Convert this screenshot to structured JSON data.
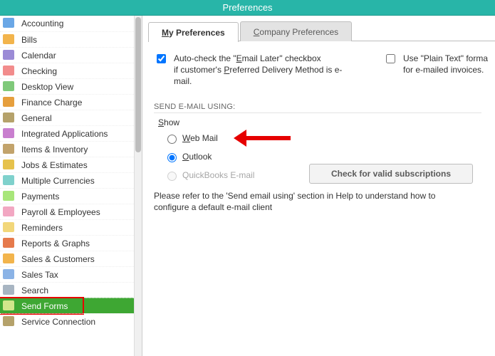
{
  "title": "Preferences",
  "sidebar": {
    "items": [
      {
        "label": "Accounting"
      },
      {
        "label": "Bills"
      },
      {
        "label": "Calendar"
      },
      {
        "label": "Checking"
      },
      {
        "label": "Desktop View"
      },
      {
        "label": "Finance Charge"
      },
      {
        "label": "General"
      },
      {
        "label": "Integrated Applications"
      },
      {
        "label": "Items & Inventory"
      },
      {
        "label": "Jobs & Estimates"
      },
      {
        "label": "Multiple Currencies"
      },
      {
        "label": "Payments"
      },
      {
        "label": "Payroll & Employees"
      },
      {
        "label": "Reminders"
      },
      {
        "label": "Reports & Graphs"
      },
      {
        "label": "Sales & Customers"
      },
      {
        "label": "Sales Tax"
      },
      {
        "label": "Search"
      },
      {
        "label": "Send Forms"
      },
      {
        "label": "Service Connection"
      }
    ],
    "selected_index": 18
  },
  "tabs": {
    "my_hotkey": "M",
    "my_rest": "y Preferences",
    "company_hotkey": "C",
    "company_rest": "ompany Preferences",
    "active": "my"
  },
  "auto_check": {
    "checked": true,
    "line1_pre": "Auto-check the \"",
    "line1_hot": "E",
    "line1_post": "mail Later\" checkbox",
    "line2_pre": "if customer's ",
    "line2_hot": "P",
    "line2_post": "referred Delivery Method is e-mail."
  },
  "plain_text": {
    "checked": false,
    "line1": "Use \"Plain Text\" forma",
    "line2": "for e-mailed invoices."
  },
  "group_label": "SEND E-MAIL USING:",
  "show_hot": "S",
  "show_rest": "how",
  "radios": {
    "webmail_hot": "W",
    "webmail_rest": "eb Mail",
    "outlook_hot": "O",
    "outlook_rest": "utlook",
    "qb_label": "QuickBooks E-mail",
    "selected": "outlook"
  },
  "button_label": "Check for valid subscriptions",
  "help_text": "Please refer to the 'Send email using' section in Help to understand how to configure a default e-mail client"
}
